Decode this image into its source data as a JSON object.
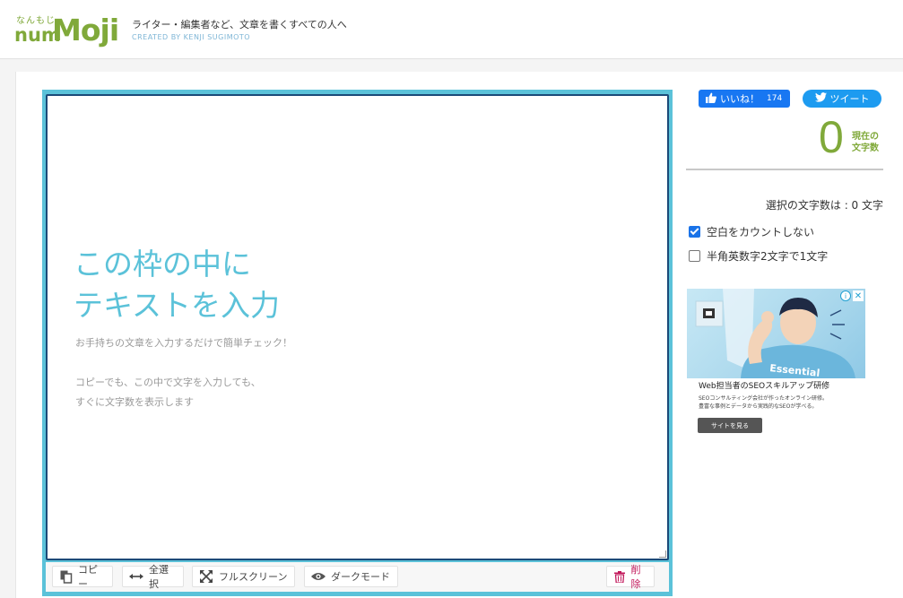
{
  "header": {
    "logo_kana": "なんもじ",
    "logo_num": "num",
    "logo_moji": "Moji",
    "tagline": "ライター・編集者など、文章を書くすべての人へ",
    "credit": "CREATED BY KENJI SUGIMOTO"
  },
  "editor": {
    "placeholder_line1": "この枠の中に",
    "placeholder_line2": "テキストを入力",
    "placeholder_sub": "お手持ちの文章を入力するだけで簡単チェック！",
    "placeholder_desc1": "コピーでも、この中で文字を入力しても、",
    "placeholder_desc2": "すぐに文字数を表示します"
  },
  "toolbar": {
    "copy_label": "コピー",
    "select_all_label": "全選択",
    "fullscreen_label": "フルスクリーン",
    "dark_mode_label": "ダークモード",
    "delete_label": "削除"
  },
  "social": {
    "like_label": "いいね！",
    "like_count": "174",
    "tweet_label": "ツイート"
  },
  "counter": {
    "value": "0",
    "label_line1": "現在の",
    "label_line2": "文字数",
    "selection_text": "選択の文字数は : 0 文字"
  },
  "options": [
    {
      "label": "空白をカウントしない",
      "checked": true
    },
    {
      "label": "半角英数字2文字で1文字",
      "checked": false
    }
  ],
  "ad": {
    "title": "Web担当者のSEOスキルアップ研修",
    "desc_line1": "SEOコンサルティング会社が作ったオンライン研修。",
    "desc_line2": "豊富な事例とデータから実践的なSEOが学べる。",
    "cta": "サイトを見る",
    "shirt_text": "Essential"
  },
  "colors": {
    "brand_green": "#80a93a",
    "editor_accent": "#5bc2d9",
    "facebook": "#1877f2",
    "twitter": "#1d9bf0",
    "delete": "#c2185b"
  }
}
